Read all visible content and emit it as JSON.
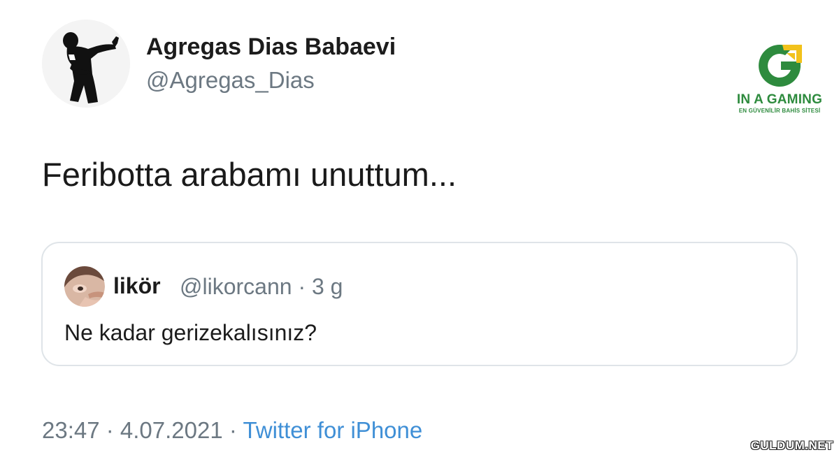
{
  "tweet": {
    "author": {
      "display_name": "Agregas Dias Babaevi",
      "handle": "@Agregas_Dias",
      "avatar_icon": "dancing-silhouette-icon"
    },
    "text": "Feribotta arabamı unuttum...",
    "quoted_tweet": {
      "author_name": "likör",
      "meta": "@likorcann · 3 g",
      "text": "Ne kadar gerizekalısınız?",
      "avatar_icon": "face-photo-icon"
    },
    "footer": {
      "timestamp": "23:47 · 4.07.2021 · ",
      "source": "Twitter for iPhone"
    }
  },
  "overlay": {
    "brand_logo": {
      "icon": "g-letter-logo-icon",
      "title": "IN A GAMING",
      "subtitle": "EN GÜVENİLİR BAHİS SİTESİ"
    },
    "watermark": "GULDUM.NET"
  },
  "colors": {
    "text_primary": "#1c1c1c",
    "text_secondary": "#6c7882",
    "link": "#3f8fd6",
    "border": "#dfe4e8",
    "brand_green": "#2e8b3e",
    "brand_yellow": "#f2c21b"
  }
}
